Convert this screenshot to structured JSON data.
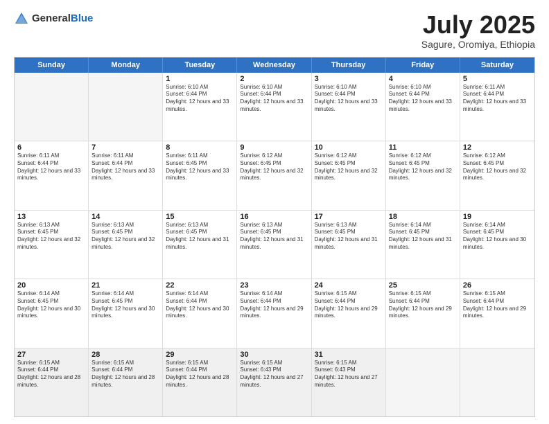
{
  "header": {
    "logo": {
      "general": "General",
      "blue": "Blue"
    },
    "title": "July 2025",
    "location": "Sagure, Oromiya, Ethiopia"
  },
  "calendar": {
    "weekdays": [
      "Sunday",
      "Monday",
      "Tuesday",
      "Wednesday",
      "Thursday",
      "Friday",
      "Saturday"
    ],
    "weeks": [
      [
        {
          "day": "",
          "sunrise": "",
          "sunset": "",
          "daylight": "",
          "empty": true
        },
        {
          "day": "",
          "sunrise": "",
          "sunset": "",
          "daylight": "",
          "empty": true
        },
        {
          "day": "1",
          "sunrise": "Sunrise: 6:10 AM",
          "sunset": "Sunset: 6:44 PM",
          "daylight": "Daylight: 12 hours and 33 minutes.",
          "empty": false
        },
        {
          "day": "2",
          "sunrise": "Sunrise: 6:10 AM",
          "sunset": "Sunset: 6:44 PM",
          "daylight": "Daylight: 12 hours and 33 minutes.",
          "empty": false
        },
        {
          "day": "3",
          "sunrise": "Sunrise: 6:10 AM",
          "sunset": "Sunset: 6:44 PM",
          "daylight": "Daylight: 12 hours and 33 minutes.",
          "empty": false
        },
        {
          "day": "4",
          "sunrise": "Sunrise: 6:10 AM",
          "sunset": "Sunset: 6:44 PM",
          "daylight": "Daylight: 12 hours and 33 minutes.",
          "empty": false
        },
        {
          "day": "5",
          "sunrise": "Sunrise: 6:11 AM",
          "sunset": "Sunset: 6:44 PM",
          "daylight": "Daylight: 12 hours and 33 minutes.",
          "empty": false
        }
      ],
      [
        {
          "day": "6",
          "sunrise": "Sunrise: 6:11 AM",
          "sunset": "Sunset: 6:44 PM",
          "daylight": "Daylight: 12 hours and 33 minutes.",
          "empty": false
        },
        {
          "day": "7",
          "sunrise": "Sunrise: 6:11 AM",
          "sunset": "Sunset: 6:44 PM",
          "daylight": "Daylight: 12 hours and 33 minutes.",
          "empty": false
        },
        {
          "day": "8",
          "sunrise": "Sunrise: 6:11 AM",
          "sunset": "Sunset: 6:45 PM",
          "daylight": "Daylight: 12 hours and 33 minutes.",
          "empty": false
        },
        {
          "day": "9",
          "sunrise": "Sunrise: 6:12 AM",
          "sunset": "Sunset: 6:45 PM",
          "daylight": "Daylight: 12 hours and 32 minutes.",
          "empty": false
        },
        {
          "day": "10",
          "sunrise": "Sunrise: 6:12 AM",
          "sunset": "Sunset: 6:45 PM",
          "daylight": "Daylight: 12 hours and 32 minutes.",
          "empty": false
        },
        {
          "day": "11",
          "sunrise": "Sunrise: 6:12 AM",
          "sunset": "Sunset: 6:45 PM",
          "daylight": "Daylight: 12 hours and 32 minutes.",
          "empty": false
        },
        {
          "day": "12",
          "sunrise": "Sunrise: 6:12 AM",
          "sunset": "Sunset: 6:45 PM",
          "daylight": "Daylight: 12 hours and 32 minutes.",
          "empty": false
        }
      ],
      [
        {
          "day": "13",
          "sunrise": "Sunrise: 6:13 AM",
          "sunset": "Sunset: 6:45 PM",
          "daylight": "Daylight: 12 hours and 32 minutes.",
          "empty": false
        },
        {
          "day": "14",
          "sunrise": "Sunrise: 6:13 AM",
          "sunset": "Sunset: 6:45 PM",
          "daylight": "Daylight: 12 hours and 32 minutes.",
          "empty": false
        },
        {
          "day": "15",
          "sunrise": "Sunrise: 6:13 AM",
          "sunset": "Sunset: 6:45 PM",
          "daylight": "Daylight: 12 hours and 31 minutes.",
          "empty": false
        },
        {
          "day": "16",
          "sunrise": "Sunrise: 6:13 AM",
          "sunset": "Sunset: 6:45 PM",
          "daylight": "Daylight: 12 hours and 31 minutes.",
          "empty": false
        },
        {
          "day": "17",
          "sunrise": "Sunrise: 6:13 AM",
          "sunset": "Sunset: 6:45 PM",
          "daylight": "Daylight: 12 hours and 31 minutes.",
          "empty": false
        },
        {
          "day": "18",
          "sunrise": "Sunrise: 6:14 AM",
          "sunset": "Sunset: 6:45 PM",
          "daylight": "Daylight: 12 hours and 31 minutes.",
          "empty": false
        },
        {
          "day": "19",
          "sunrise": "Sunrise: 6:14 AM",
          "sunset": "Sunset: 6:45 PM",
          "daylight": "Daylight: 12 hours and 30 minutes.",
          "empty": false
        }
      ],
      [
        {
          "day": "20",
          "sunrise": "Sunrise: 6:14 AM",
          "sunset": "Sunset: 6:45 PM",
          "daylight": "Daylight: 12 hours and 30 minutes.",
          "empty": false
        },
        {
          "day": "21",
          "sunrise": "Sunrise: 6:14 AM",
          "sunset": "Sunset: 6:45 PM",
          "daylight": "Daylight: 12 hours and 30 minutes.",
          "empty": false
        },
        {
          "day": "22",
          "sunrise": "Sunrise: 6:14 AM",
          "sunset": "Sunset: 6:44 PM",
          "daylight": "Daylight: 12 hours and 30 minutes.",
          "empty": false
        },
        {
          "day": "23",
          "sunrise": "Sunrise: 6:14 AM",
          "sunset": "Sunset: 6:44 PM",
          "daylight": "Daylight: 12 hours and 29 minutes.",
          "empty": false
        },
        {
          "day": "24",
          "sunrise": "Sunrise: 6:15 AM",
          "sunset": "Sunset: 6:44 PM",
          "daylight": "Daylight: 12 hours and 29 minutes.",
          "empty": false
        },
        {
          "day": "25",
          "sunrise": "Sunrise: 6:15 AM",
          "sunset": "Sunset: 6:44 PM",
          "daylight": "Daylight: 12 hours and 29 minutes.",
          "empty": false
        },
        {
          "day": "26",
          "sunrise": "Sunrise: 6:15 AM",
          "sunset": "Sunset: 6:44 PM",
          "daylight": "Daylight: 12 hours and 29 minutes.",
          "empty": false
        }
      ],
      [
        {
          "day": "27",
          "sunrise": "Sunrise: 6:15 AM",
          "sunset": "Sunset: 6:44 PM",
          "daylight": "Daylight: 12 hours and 28 minutes.",
          "empty": false
        },
        {
          "day": "28",
          "sunrise": "Sunrise: 6:15 AM",
          "sunset": "Sunset: 6:44 PM",
          "daylight": "Daylight: 12 hours and 28 minutes.",
          "empty": false
        },
        {
          "day": "29",
          "sunrise": "Sunrise: 6:15 AM",
          "sunset": "Sunset: 6:44 PM",
          "daylight": "Daylight: 12 hours and 28 minutes.",
          "empty": false
        },
        {
          "day": "30",
          "sunrise": "Sunrise: 6:15 AM",
          "sunset": "Sunset: 6:43 PM",
          "daylight": "Daylight: 12 hours and 27 minutes.",
          "empty": false
        },
        {
          "day": "31",
          "sunrise": "Sunrise: 6:15 AM",
          "sunset": "Sunset: 6:43 PM",
          "daylight": "Daylight: 12 hours and 27 minutes.",
          "empty": false
        },
        {
          "day": "",
          "sunrise": "",
          "sunset": "",
          "daylight": "",
          "empty": true
        },
        {
          "day": "",
          "sunrise": "",
          "sunset": "",
          "daylight": "",
          "empty": true
        }
      ]
    ]
  }
}
